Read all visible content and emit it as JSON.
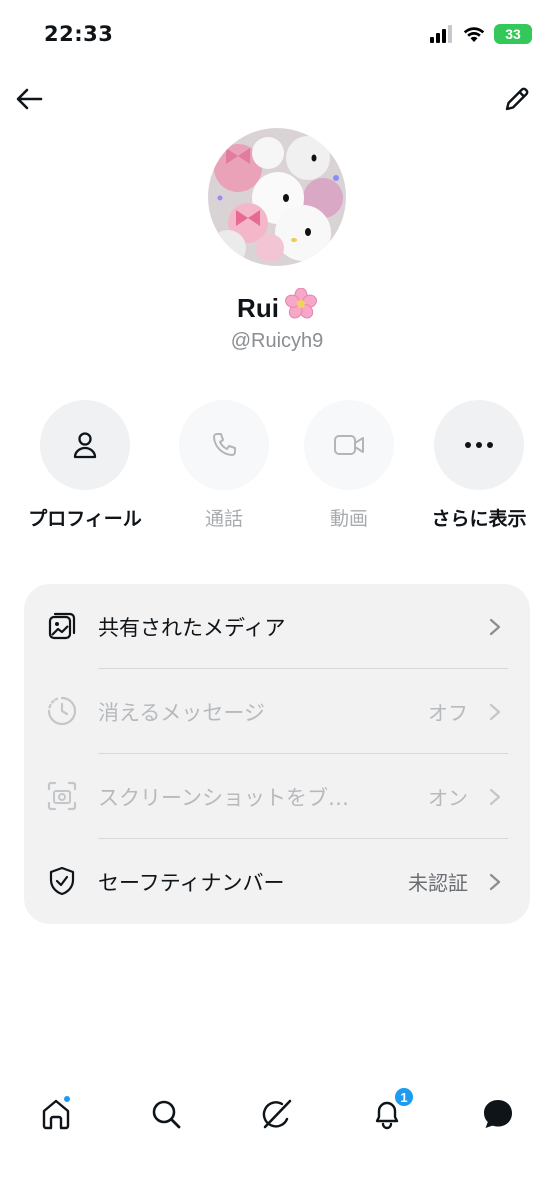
{
  "status_bar": {
    "time": "22:33",
    "battery": "33"
  },
  "profile": {
    "name": "Rui",
    "handle": "@Ruicyh9",
    "name_emoji": "cherry-blossom-icon"
  },
  "actions": [
    {
      "label": "プロフィール",
      "icon": "person-icon",
      "enabled": true
    },
    {
      "label": "通話",
      "icon": "phone-icon",
      "enabled": false
    },
    {
      "label": "動画",
      "icon": "video-camera-icon",
      "enabled": false
    },
    {
      "label": "さらに表示",
      "icon": "more-dots-icon",
      "enabled": true
    }
  ],
  "settings": [
    {
      "label": "共有されたメディア",
      "value": "",
      "icon": "media-gallery-icon",
      "enabled": true
    },
    {
      "label": "消えるメッセージ",
      "value": "オフ",
      "icon": "timer-icon",
      "enabled": false
    },
    {
      "label": "スクリーンショットをブ…",
      "value": "オン",
      "icon": "screenshot-camera-icon",
      "enabled": false
    },
    {
      "label": "セーフティナンバー",
      "value": "未認証",
      "icon": "shield-check-icon",
      "enabled": true
    }
  ],
  "tabbar": {
    "tabs": [
      "home-icon",
      "search-icon",
      "grok-icon",
      "notifications-icon",
      "messages-icon"
    ],
    "notifications_badge": "1"
  },
  "colors": {
    "accent": "#1d9bf0",
    "card_bg": "#f2f2f3",
    "battery": "#34c759"
  }
}
